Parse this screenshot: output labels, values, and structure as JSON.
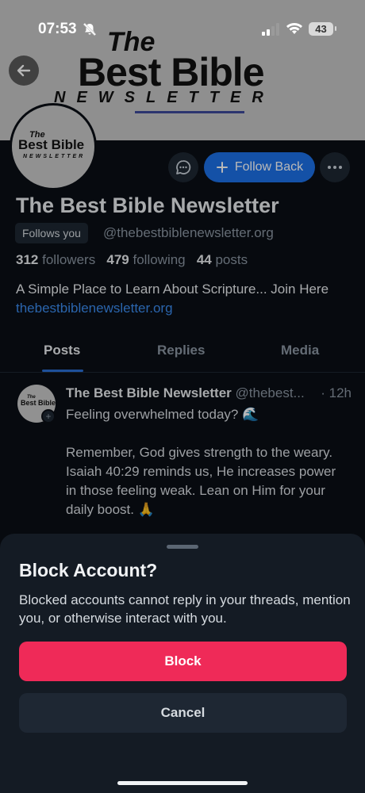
{
  "status_bar": {
    "time": "07:53",
    "battery": "43"
  },
  "banner": {
    "logo_the": "The",
    "logo_main": "Best Bible",
    "logo_newsletter": "NEWSLETTER"
  },
  "avatar": {
    "logo_the": "The",
    "logo_main": "Best Bible",
    "logo_newsletter": "NEWSLETTER"
  },
  "profile": {
    "follow_button": "Follow Back",
    "display_name": "The Best Bible Newsletter",
    "follows_you": "Follows you",
    "handle": "@thebestbiblenewsletter.org",
    "followers_count": "312",
    "followers_label": "followers",
    "following_count": "479",
    "following_label": "following",
    "posts_count": "44",
    "posts_label": "posts",
    "bio_text": "A Simple Place to Learn About Scripture... Join Here",
    "bio_link": "thebestbiblenewsletter.org"
  },
  "tabs": [
    {
      "label": "Posts"
    },
    {
      "label": "Replies"
    },
    {
      "label": "Media"
    }
  ],
  "post": {
    "avatar_the": "The",
    "avatar_main": "Best Bible",
    "author": "The Best Bible Newsletter",
    "handle": "@thebest...",
    "time": "· 12h",
    "line1": "Feeling overwhelmed today? 🌊",
    "line2": "Remember, God gives strength to the weary. Isaiah 40:29 reminds us, He increases power in those feeling weak. Lean on Him for your daily boost. 🙏"
  },
  "sheet": {
    "title": "Block Account?",
    "description": "Blocked accounts cannot reply in your threads, mention you, or otherwise interact with you.",
    "block_label": "Block",
    "cancel_label": "Cancel"
  },
  "colors": {
    "accent": "#1d71e8",
    "danger": "#ef2a58",
    "background": "#0b0f15",
    "sheet": "#141b24"
  }
}
